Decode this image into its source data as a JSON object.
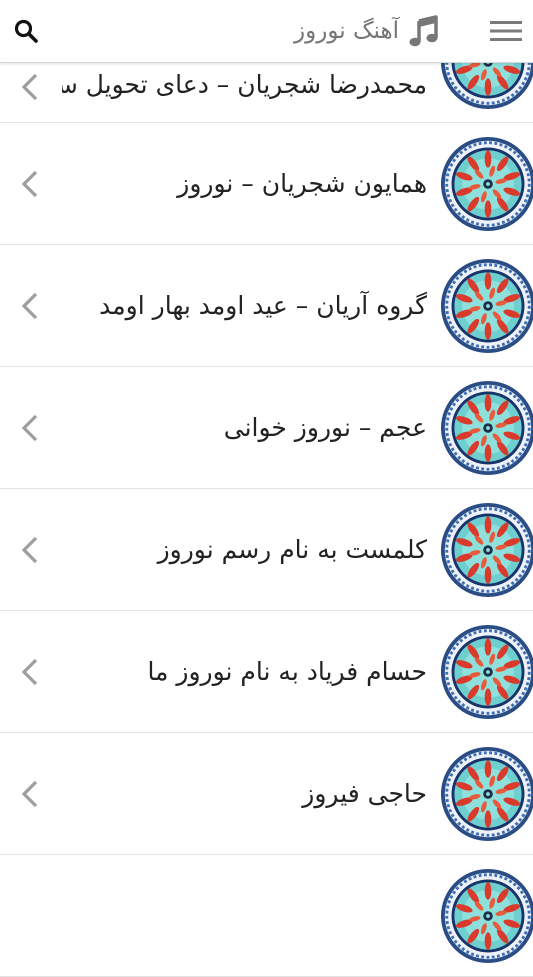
{
  "header": {
    "title": "آهنگ نوروز",
    "menu_icon": "hamburger-menu-icon",
    "title_icon": "music-note-icon",
    "search_icon": "search-icon"
  },
  "colors": {
    "title": "#757575",
    "item_text": "#222222",
    "chevron": "#9e9e9e",
    "divider": "#e2e2e2"
  },
  "items": [
    {
      "label": "محمدرضا شجریان – دعای تحویل سال"
    },
    {
      "label": "همایون شجریان – نوروز"
    },
    {
      "label": "گروه آریان – عید اومد بهار اومد"
    },
    {
      "label": "عجم – نوروز خوانی"
    },
    {
      "label": "کلمست به نام رسم نوروز"
    },
    {
      "label": "حسام فریاد به نام نوروز ما"
    },
    {
      "label": "حاجی فیروز"
    },
    {
      "label": ""
    }
  ]
}
